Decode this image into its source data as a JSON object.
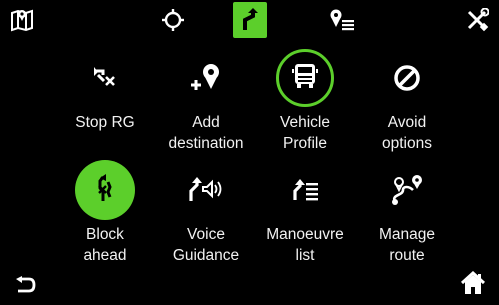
{
  "colors": {
    "accent": "#5ccf2b",
    "background": "#000000",
    "text": "#f2f2f2"
  },
  "topbar": {
    "icons": [
      "map-book-icon",
      "crosshair-icon",
      "route-turn-icon",
      "pin-list-icon",
      "settings-tools-icon"
    ]
  },
  "menu": {
    "items": [
      {
        "lines": [
          "Stop RG"
        ],
        "icon": "stop-route-guidance-icon",
        "state": "normal"
      },
      {
        "lines": [
          "Add",
          "destination"
        ],
        "icon": "add-destination-icon",
        "state": "normal"
      },
      {
        "lines": [
          "Vehicle",
          "Profile"
        ],
        "icon": "truck-icon",
        "state": "ringed"
      },
      {
        "lines": [
          "Avoid",
          "options"
        ],
        "icon": "avoid-icon",
        "state": "normal"
      },
      {
        "lines": [
          "Block",
          "ahead"
        ],
        "icon": "block-ahead-icon",
        "state": "active"
      },
      {
        "lines": [
          "Voice",
          "Guidance"
        ],
        "icon": "voice-guidance-icon",
        "state": "normal"
      },
      {
        "lines": [
          "Manoeuvre",
          "list"
        ],
        "icon": "manoeuvre-list-icon",
        "state": "normal"
      },
      {
        "lines": [
          "Manage",
          "route"
        ],
        "icon": "manage-route-icon",
        "state": "normal"
      }
    ]
  },
  "bottombar": {
    "back_icon": "back-arrow-icon",
    "home_icon": "home-icon"
  }
}
